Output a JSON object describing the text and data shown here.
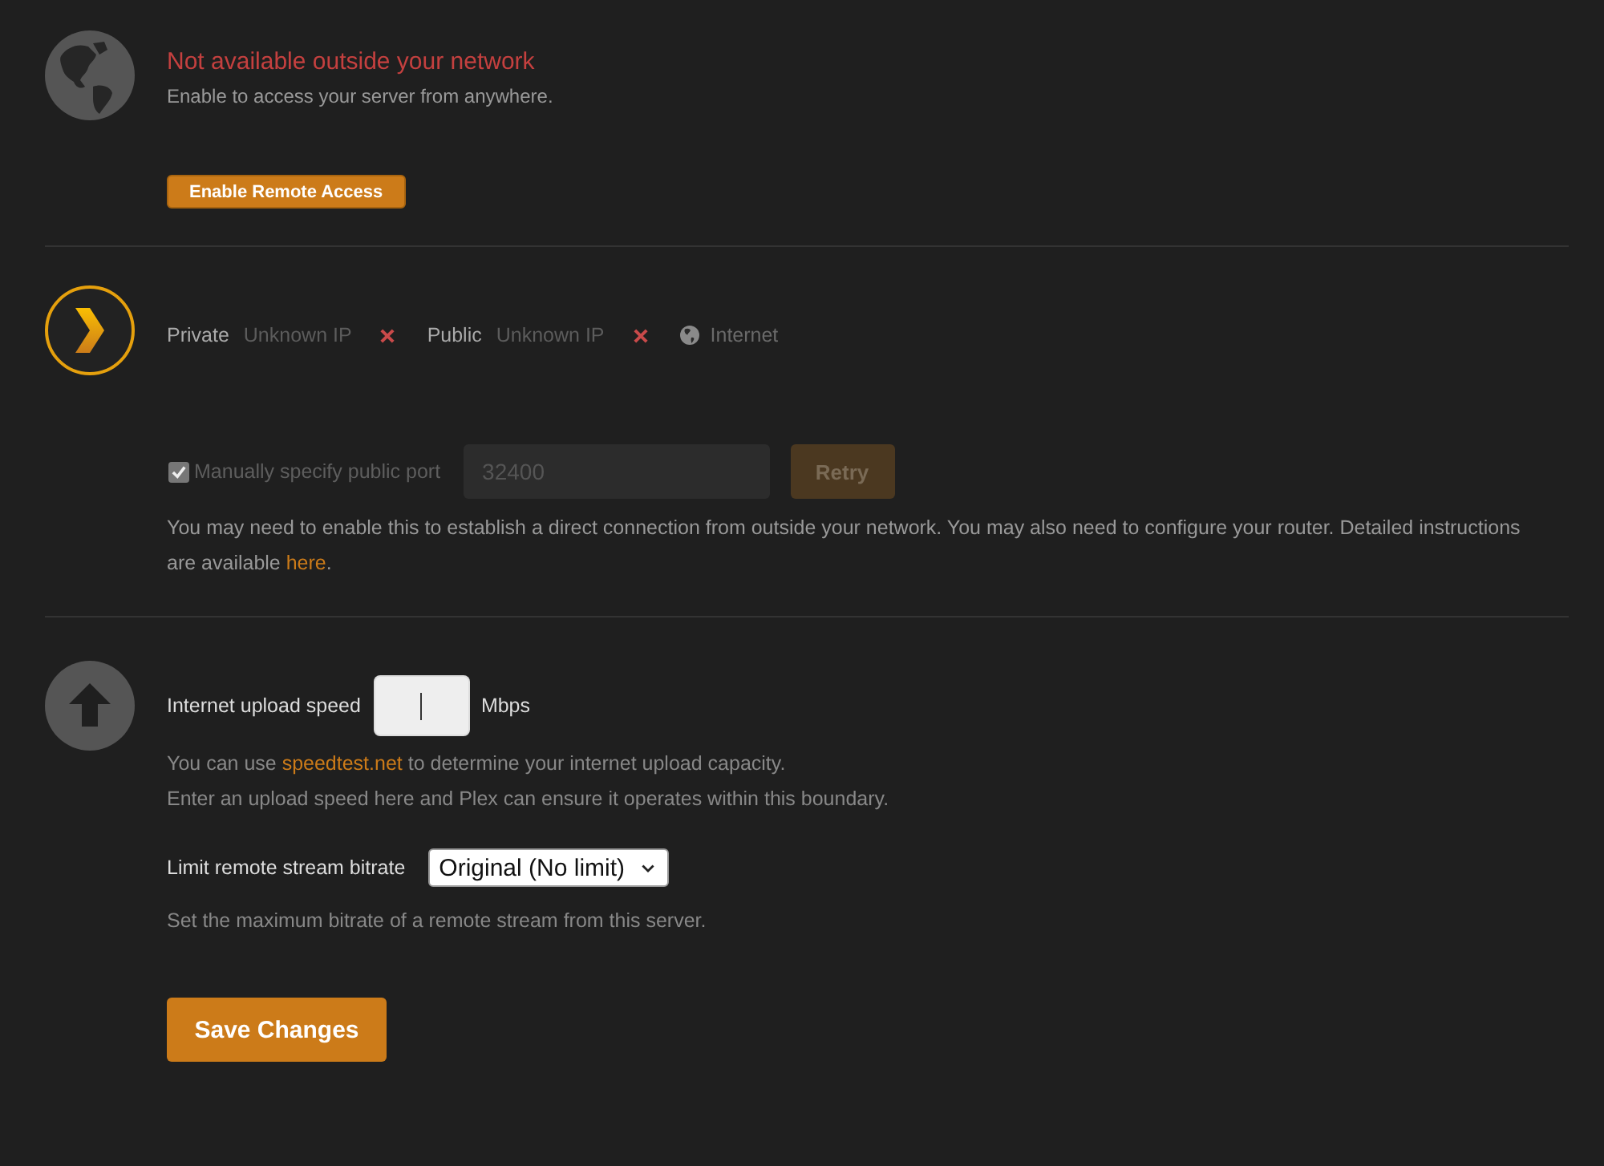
{
  "remote_access": {
    "available": false,
    "title": "Not available outside your network",
    "subtitle": "Enable to access your server from anywhere.",
    "button": "Enable Remote Access"
  },
  "connection": {
    "addresses": [
      {
        "label": "Private",
        "value": "Unknown IP",
        "reachable": false
      },
      {
        "label": "Public",
        "value": "Unknown IP",
        "reachable": false
      }
    ],
    "internet": {
      "label": "Internet"
    }
  },
  "manual_port": {
    "label": "Manually specify public port",
    "checked": true,
    "disabled": true,
    "port": "32400",
    "retry": "Retry",
    "help": {
      "text": "You may need to enable this to establish a direct connection from outside your network. You may also need to configure your router. Detailed instructions are available ",
      "link": "here",
      "end": "."
    }
  },
  "upload_speed": {
    "label": "Internet upload speed",
    "focused": true,
    "unit": "Mbps",
    "help": [
      {
        "text": "You can use ",
        "link": "speedtest.net",
        "end": " to determine your internet upload capacity."
      },
      {
        "text": "Enter an upload speed here and Plex can ensure it operates within this boundary."
      }
    ]
  },
  "stream_bitrate": {
    "label": "Limit remote stream bitrate",
    "value": "Original (No limit)",
    "help": "Set the maximum bitrate of a remote stream from this server."
  },
  "save_button": "Save Changes"
}
